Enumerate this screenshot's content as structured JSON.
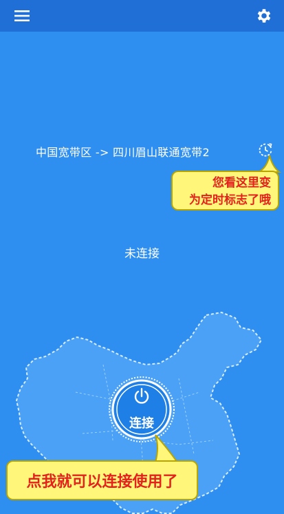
{
  "header": {
    "menu_icon": "hamburger-menu-icon",
    "settings_icon": "gear-icon"
  },
  "route": {
    "text": "中国宽带区 -> 四川眉山联通宽带2",
    "timer_icon": "timer-icon"
  },
  "annotations": {
    "timer_hint_line1": "您看这里变",
    "timer_hint_line2": "为定时标志了哦",
    "connect_hint": "点我就可以连接使用了"
  },
  "status": {
    "text": "未连接"
  },
  "connect": {
    "label": "连接",
    "icon": "power-icon"
  },
  "colors": {
    "background": "#2f8ff0",
    "appbar": "#1f6fd6",
    "callout_bg": "#fff67a",
    "callout_text": "#e3211d"
  }
}
